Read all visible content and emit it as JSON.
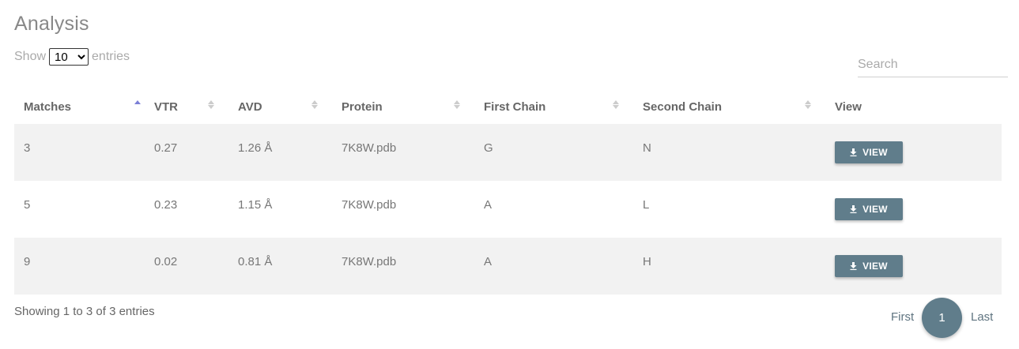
{
  "page": {
    "title": "Analysis"
  },
  "length_control": {
    "show_label": "Show",
    "entries_label": "entries",
    "selected": "10",
    "options": [
      "10"
    ]
  },
  "search": {
    "placeholder": "Search",
    "value": ""
  },
  "table": {
    "columns": [
      "Matches",
      "VTR",
      "AVD",
      "Protein",
      "First Chain",
      "Second Chain",
      "View"
    ],
    "rows": [
      {
        "matches": "3",
        "vtr": "0.27",
        "avd": "1.26 Å",
        "protein": "7K8W.pdb",
        "first_chain": "G",
        "second_chain": "N",
        "view_label": "VIEW"
      },
      {
        "matches": "5",
        "vtr": "0.23",
        "avd": "1.15 Å",
        "protein": "7K8W.pdb",
        "first_chain": "A",
        "second_chain": "L",
        "view_label": "VIEW"
      },
      {
        "matches": "9",
        "vtr": "0.02",
        "avd": "0.81 Å",
        "protein": "7K8W.pdb",
        "first_chain": "A",
        "second_chain": "H",
        "view_label": "VIEW"
      }
    ],
    "sort": {
      "column": "Matches",
      "direction": "ascending"
    }
  },
  "footer": {
    "info": "Showing 1 to 3 of 3 entries"
  },
  "pagination": {
    "first": "First",
    "current": "1",
    "last": "Last"
  },
  "colors": {
    "accent": "#607d8b",
    "sort_active": "#7b7fd6",
    "row_stripe": "#f2f2f2"
  },
  "icons": {
    "view_button_icon": "download-icon",
    "sort_icon": "sort-arrows-icon"
  }
}
